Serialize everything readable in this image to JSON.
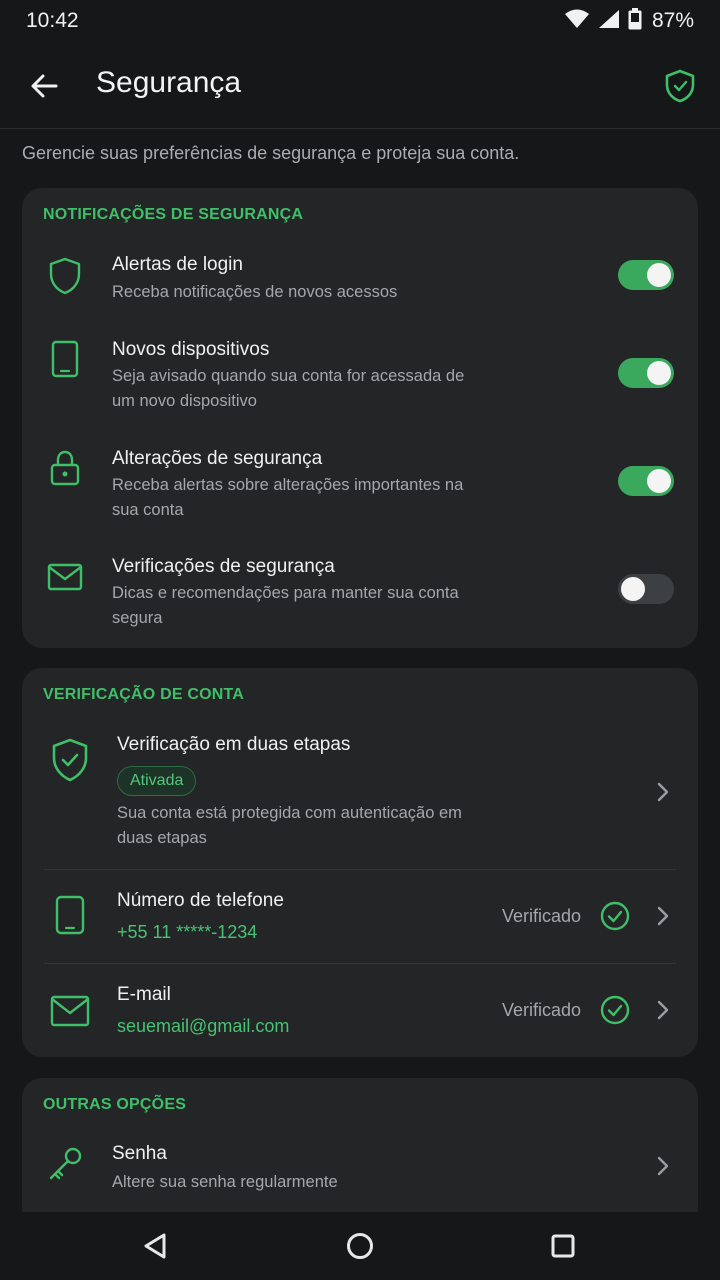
{
  "status": {
    "time": "10:42",
    "battery": "87%"
  },
  "header": {
    "title": "Segurança"
  },
  "subtitle": "Gerencie suas preferências de segurança e proteja sua conta.",
  "notifications": {
    "section_title": "NOTIFICAÇÕES DE SEGURANÇA",
    "items": [
      {
        "title": "Alertas de login",
        "desc": "Receba notificações de novos acessos",
        "enabled": true
      },
      {
        "title": "Novos dispositivos",
        "desc": "Seja avisado quando sua conta for acessada de um novo dispositivo",
        "enabled": true
      },
      {
        "title": "Alterações de segurança",
        "desc": "Receba alertas sobre alterações importantes na sua conta",
        "enabled": true
      },
      {
        "title": "Verificações de segurança",
        "desc": "Dicas e recomendações para manter sua conta segura",
        "enabled": false
      }
    ]
  },
  "verification": {
    "section_title": "VERIFICAÇÃO DE CONTA",
    "two_step": {
      "title": "Verificação em duas etapas",
      "badge": "Ativada",
      "desc": "Sua conta está protegida com autenticação em duas etapas"
    },
    "phone": {
      "title": "Número de telefone",
      "value": "+55 11 *****-1234",
      "status": "Verificado"
    },
    "email": {
      "title": "E-mail",
      "value": "seuemail@gmail.com",
      "status": "Verificado"
    }
  },
  "other": {
    "section_title": "OUTRAS OPÇÕES",
    "password": {
      "title": "Senha",
      "desc": "Altere sua senha regularmente"
    }
  },
  "colors": {
    "accent": "#3fbf67",
    "background": "#161718",
    "card": "#232527",
    "toggle_on": "#3aa85d"
  }
}
